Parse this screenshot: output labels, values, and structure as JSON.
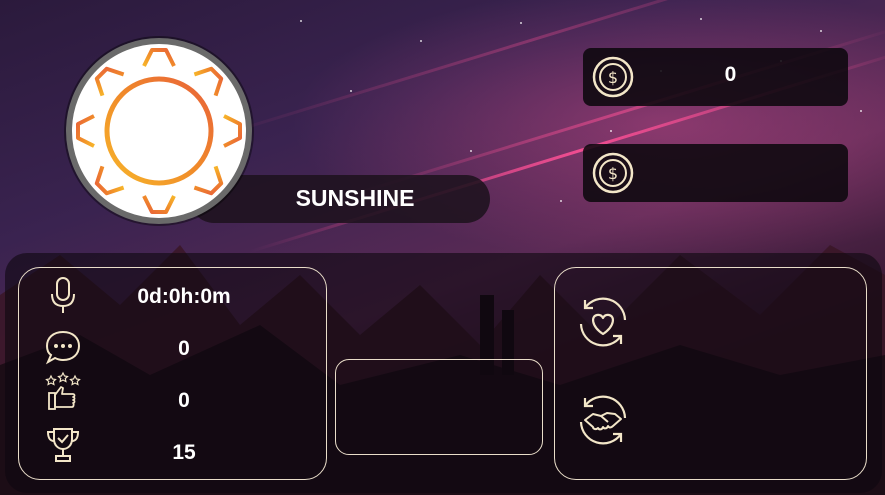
{
  "profile": {
    "name": "SUNSHINE",
    "avatar_icon": "sun-icon",
    "avatar_colors": [
      "#f7b52a",
      "#f08a2a",
      "#e8613a"
    ]
  },
  "currency": [
    {
      "icon": "dollar-coin-icon",
      "value": "0"
    },
    {
      "icon": "dollar-coin-icon",
      "value": ""
    }
  ],
  "stats": [
    {
      "icon": "microphone-icon",
      "value": "0d:0h:0m"
    },
    {
      "icon": "chat-bubble-icon",
      "value": "0"
    },
    {
      "icon": "thumbs-up-stars-icon",
      "value": "0"
    },
    {
      "icon": "trophy-icon",
      "value": "15"
    }
  ],
  "actions": [
    {
      "icon": "heart-refresh-icon"
    },
    {
      "icon": "handshake-refresh-icon"
    }
  ],
  "colors": {
    "outline": "#e9ddc9",
    "accent_pink": "#ff4f95",
    "panel_bg": "#0e0810"
  }
}
